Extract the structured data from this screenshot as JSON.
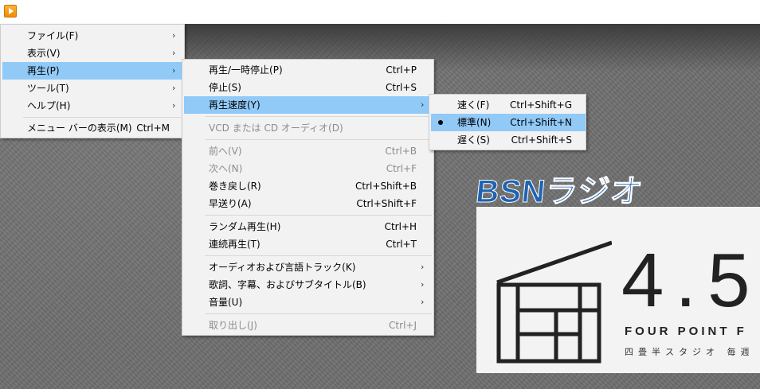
{
  "menu_main": {
    "items": [
      {
        "label": "ファイル(F)"
      },
      {
        "label": "表示(V)"
      },
      {
        "label": "再生(P)"
      },
      {
        "label": "ツール(T)"
      },
      {
        "label": "ヘルプ(H)"
      },
      {
        "label": "メニュー バーの表示(M)",
        "shortcut": "Ctrl+M"
      }
    ]
  },
  "menu_playback": {
    "items": [
      {
        "label": "再生/一時停止(P)",
        "shortcut": "Ctrl+P"
      },
      {
        "label": "停止(S)",
        "shortcut": "Ctrl+S"
      },
      {
        "label": "再生速度(Y)"
      },
      {
        "label": "VCD または CD オーディオ(D)"
      },
      {
        "label": "前へ(V)",
        "shortcut": "Ctrl+B"
      },
      {
        "label": "次へ(N)",
        "shortcut": "Ctrl+F"
      },
      {
        "label": "巻き戻し(R)",
        "shortcut": "Ctrl+Shift+B"
      },
      {
        "label": "早送り(A)",
        "shortcut": "Ctrl+Shift+F"
      },
      {
        "label": "ランダム再生(H)",
        "shortcut": "Ctrl+H"
      },
      {
        "label": "連続再生(T)",
        "shortcut": "Ctrl+T"
      },
      {
        "label": "オーディオおよび言語トラック(K)"
      },
      {
        "label": "歌詞、字幕、およびサブタイトル(B)"
      },
      {
        "label": "音量(U)"
      },
      {
        "label": "取り出し(J)",
        "shortcut": "Ctrl+J"
      }
    ]
  },
  "menu_speed": {
    "items": [
      {
        "label": "速く(F)",
        "shortcut": "Ctrl+Shift+G"
      },
      {
        "label": "標準(N)",
        "shortcut": "Ctrl+Shift+N"
      },
      {
        "label": "遅く(S)",
        "shortcut": "Ctrl+Shift+S"
      }
    ]
  },
  "video": {
    "logo": "BSNラジオ",
    "sign_number": "4.5",
    "sign_english": "FOUR POINT F",
    "sign_japanese": "四畳半スタジオ 毎週"
  },
  "colors": {
    "highlight": "#91c9f7",
    "menu_bg": "#f2f2f2",
    "disabled_text": "#8c8c8c",
    "logo_blue": "#1f63b3"
  }
}
